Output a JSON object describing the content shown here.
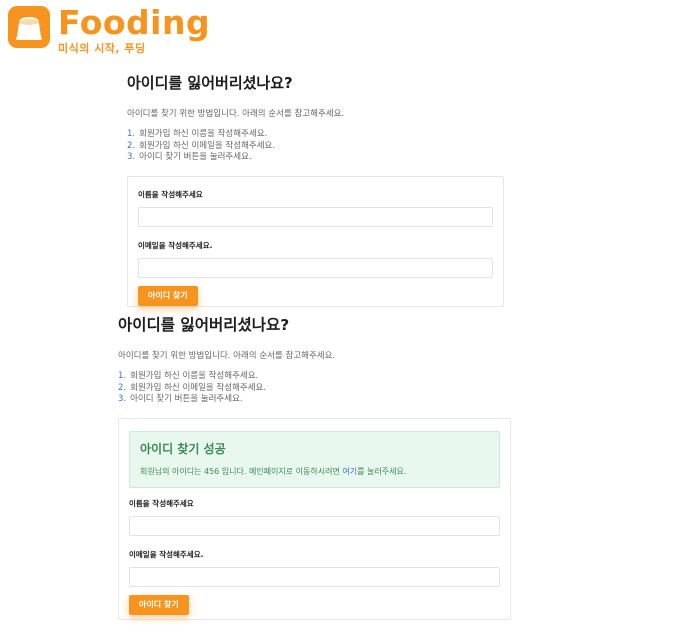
{
  "brand": {
    "title": "Fooding",
    "subtitle": "미식의 시작, 푸딩",
    "color": "#f7941d",
    "icon": "pudding-icon"
  },
  "section1": {
    "heading": "아이디를 잃어버리셨나요?",
    "description": "아이디를 찾기 위한 방법입니다. 아래의 순서를 참고해주세요.",
    "steps": [
      {
        "num": "1.",
        "text": "회원가입 하신 이름을 작성해주세요."
      },
      {
        "num": "2.",
        "text": "회원가입 하신 이메일을 작성해주세요."
      },
      {
        "num": "3.",
        "text": "아이디 찾기 버튼을 눌러주세요."
      }
    ],
    "name_label": "이름을 작성해주세요",
    "name_value": "",
    "email_label": "이메일을 작성해주세요.",
    "email_value": "",
    "button": "아이디 찾기"
  },
  "section2": {
    "heading": "아이디를 잃어버리셨나요?",
    "description": "아이디를 찾기 위한 방법입니다. 아래의 순서를 참고해주세요.",
    "steps": [
      {
        "num": "1.",
        "text": "회원가입 하신 이름을 작성해주세요."
      },
      {
        "num": "2.",
        "text": "회원가입 하신 이메일을 작성해주세요."
      },
      {
        "num": "3.",
        "text": "아이디 찾기 버튼을 눌러주세요."
      }
    ],
    "alert": {
      "title": "아이디 찾기 성공",
      "message_before": "회원님의 아이디는 456 입니다. 메인페이지로 이동하시려면 ",
      "link": "여기",
      "message_after": "를 눌러주세요."
    },
    "name_label": "이름을 작성해주세요",
    "name_value": "",
    "email_label": "이메일을 작성해주세요.",
    "email_value": "",
    "button": "아이디 찾기"
  }
}
